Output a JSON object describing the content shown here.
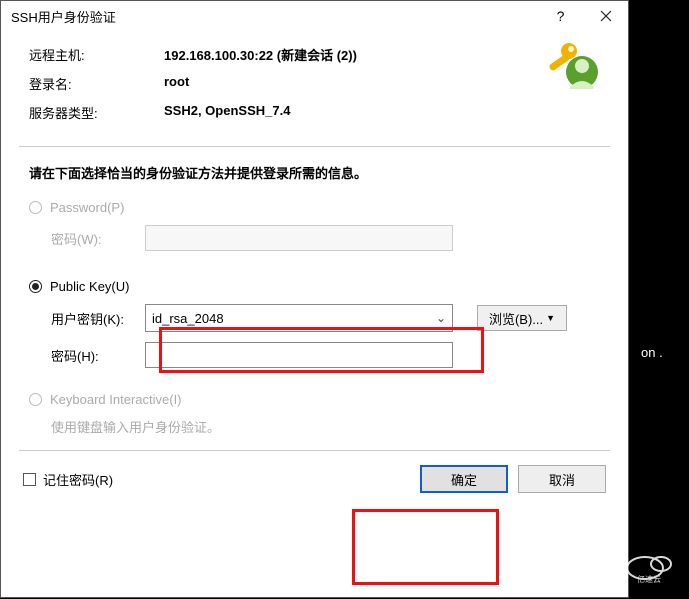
{
  "titlebar": {
    "title": "SSH用户身份验证"
  },
  "info": {
    "remote_host_label": "远程主机:",
    "remote_host_value": "192.168.100.30:22 (新建会话 (2))",
    "login_label": "登录名:",
    "login_value": "root",
    "server_type_label": "服务器类型:",
    "server_type_value": "SSH2, OpenSSH_7.4"
  },
  "section_msg": "请在下面选择恰当的身份验证方法并提供登录所需的信息。",
  "auth": {
    "password_radio": "Password(P)",
    "password_sub_label": "密码(W):",
    "publickey_radio": "Public Key(U)",
    "userkey_label": "用户密钥(K):",
    "userkey_value": "id_rsa_2048",
    "passphrase_label": "密码(H):",
    "browse_label": "浏览(B)...",
    "keyboard_radio": "Keyboard Interactive(I)",
    "keyboard_sub_msg": "使用键盘输入用户身份验证。"
  },
  "bottom": {
    "remember_label": "记住密码(R)",
    "ok_label": "确定",
    "cancel_label": "取消"
  },
  "bg": {
    "partial_text": "on ."
  },
  "watermark_text": "亿速云"
}
